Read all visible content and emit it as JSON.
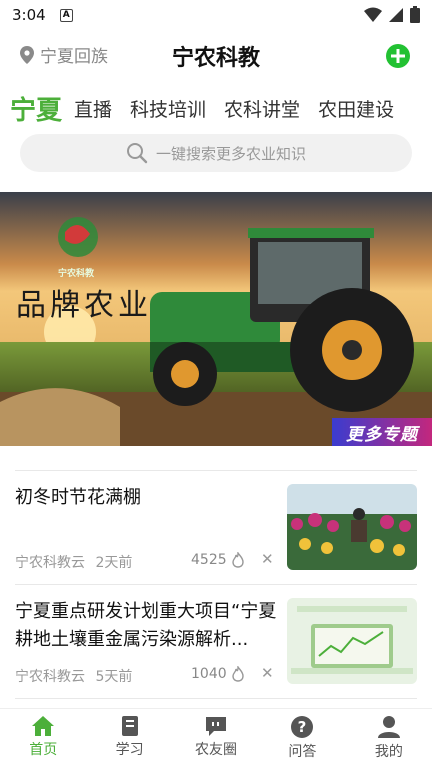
{
  "status_bar": {
    "time": "3:04",
    "notification_letter": "A"
  },
  "header": {
    "location": "宁夏回族",
    "title": "宁农科教"
  },
  "categories": [
    "宁夏",
    "直播",
    "科技培训",
    "农科讲堂",
    "农田建设"
  ],
  "search": {
    "placeholder": "一键搜索更多农业知识"
  },
  "banner": {
    "brand_text": "品牌农业",
    "logo_text": "宁农科教",
    "more_topics": "更多专题"
  },
  "news": [
    {
      "title": "初冬时节花满棚",
      "source": "宁农科教云",
      "time": "2天前",
      "count": "4525"
    },
    {
      "title": "宁夏重点研发计划重大项目“宁夏耕地土壤重金属污染源解析...",
      "source": "宁农科教云",
      "time": "5天前",
      "count": "1040"
    }
  ],
  "bottom_nav": [
    {
      "label": "首页",
      "icon": "home-icon",
      "active": true
    },
    {
      "label": "学习",
      "icon": "book-icon",
      "active": false
    },
    {
      "label": "农友圈",
      "icon": "chat-icon",
      "active": false
    },
    {
      "label": "问答",
      "icon": "question-icon",
      "active": false
    },
    {
      "label": "我的",
      "icon": "user-icon",
      "active": false
    }
  ],
  "colors": {
    "accent": "#4caf3a",
    "add_button": "#22c132"
  }
}
